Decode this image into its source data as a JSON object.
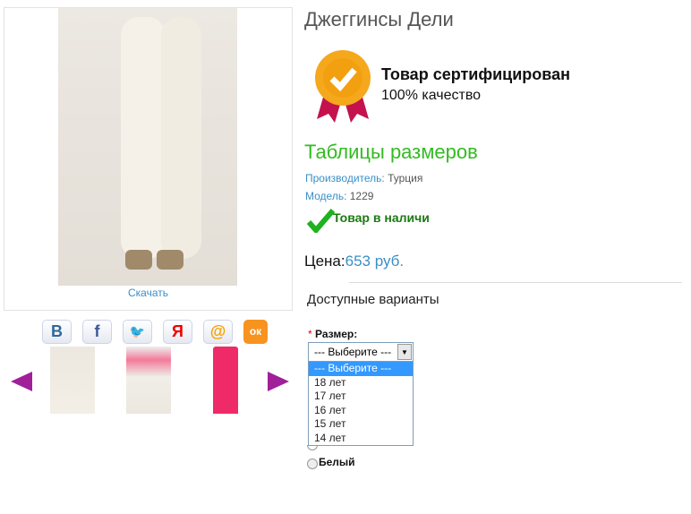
{
  "product": {
    "title": "Джеггинсы Дели",
    "download_label": "Скачать"
  },
  "certificate": {
    "title": "Товар сертифицирован",
    "subtitle": "100% качество"
  },
  "size_tables_link": "Таблицы размеров",
  "details": {
    "manufacturer_label": "Производитель:",
    "manufacturer": "Турция",
    "model_label": "Модель:",
    "model": "1229",
    "stock": "Товар в наличи"
  },
  "price": {
    "label": "Цена:",
    "value": "653 руб."
  },
  "options": {
    "title": "Доступные варианты",
    "size_label": "Размер:",
    "required_mark": "*",
    "size_selected": "--- Выберите ---",
    "size_options": [
      "--- Выберите ---",
      "18 лет",
      "17 лет",
      "16 лет",
      "15 лет",
      "14 лет"
    ],
    "color_option": "Белый"
  },
  "social": [
    {
      "icon": "vk-icon",
      "glyph": "B"
    },
    {
      "icon": "facebook-icon",
      "glyph": "f"
    },
    {
      "icon": "twitter-icon",
      "glyph": "🐦"
    },
    {
      "icon": "yaru-icon",
      "glyph": "Я"
    },
    {
      "icon": "mail-icon",
      "glyph": "@"
    },
    {
      "icon": "odnoklassniki-icon",
      "glyph": "ок"
    }
  ],
  "colors": {
    "link": "#3a8fc8",
    "green": "#33bb22",
    "stock_green": "#1b7a12",
    "arrow": "#a0209a"
  }
}
